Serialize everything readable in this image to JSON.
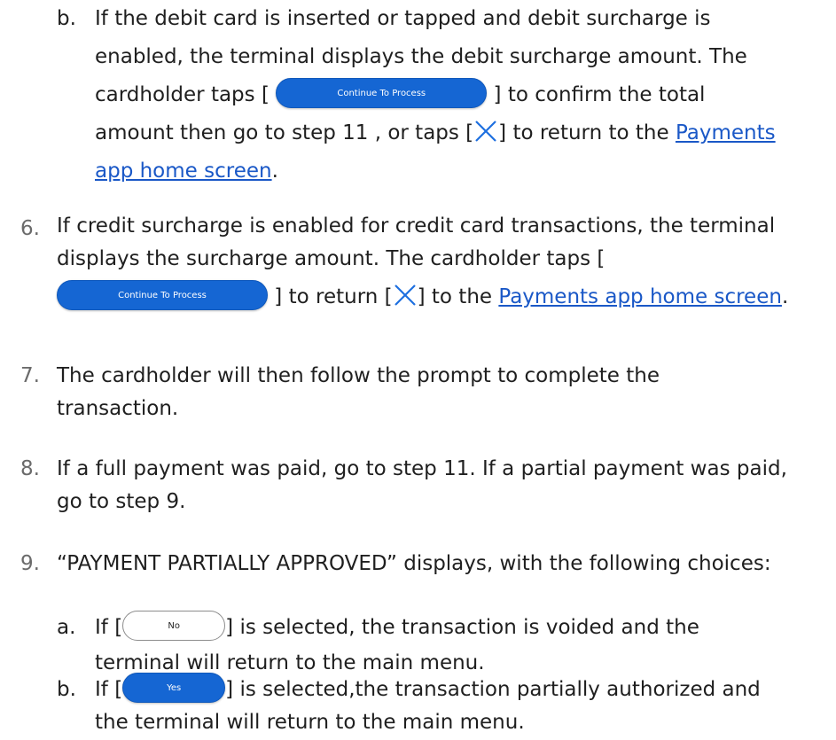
{
  "step5b": {
    "marker": "b.",
    "line1": "If the debit card is inserted or tapped and debit surcharge is",
    "line2": "enabled, the terminal displays the debit surcharge amount. The",
    "line3_before": "cardholder taps [ ",
    "continue_button": "Continue To Process",
    "line3_after": " ] to confirm the total",
    "line4_before": "amount then go to step 11 , or taps [",
    "line4_mid": "] to return to the ",
    "link_line4": "Payments",
    "link_line5": "app home screen",
    "line5_after": "."
  },
  "step6": {
    "marker": "6.",
    "line1": "If credit surcharge is enabled for credit card transactions, the terminal",
    "line2": "displays the surcharge amount.  The cardholder taps [",
    "continue_button": "Continue To Process",
    "line3_mid": " ] to return [",
    "line3_mid2": "] to the ",
    "link": "Payments app home screen",
    "line3_after": "."
  },
  "step7": {
    "marker": "7.",
    "line1": "The cardholder will then follow the prompt to complete the",
    "line2": "transaction."
  },
  "step8": {
    "marker": "8.",
    "line1": "If a full payment was paid, go to step 11.  If a partial payment was paid,",
    "line2": "go to step 9."
  },
  "step9": {
    "marker": "9.",
    "line1": "“PAYMENT PARTIALLY APPROVED” displays, with the following choices:"
  },
  "step9a": {
    "marker": "a.",
    "line1_before": "If [",
    "no_button": "No",
    "line1_after": "] is selected, the transaction is voided and the",
    "line2": "terminal will return to the main menu."
  },
  "step9b": {
    "marker": "b.",
    "line1_before": "If  [",
    "yes_button": "Yes",
    "line1_after": "] is selected,the transaction partially authorized and",
    "line2": "the terminal will return to the main menu."
  },
  "colors": {
    "text": "#1f1f1f",
    "link": "#1a58c7",
    "button_blue": "#1566d3",
    "close_icon": "#1e6fe0",
    "number_gray": "#6b6b6b"
  },
  "icons": {
    "close": "close-x-icon"
  }
}
